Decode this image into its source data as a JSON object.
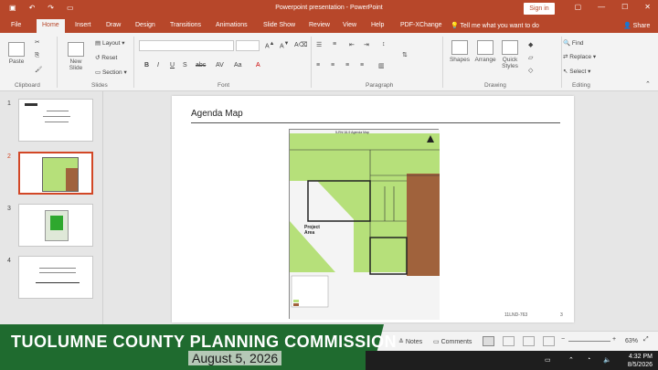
{
  "window": {
    "title": "Powerpoint presentation - PowerPoint",
    "signin": "Sign in"
  },
  "tabs": [
    "File",
    "Home",
    "Insert",
    "Draw",
    "Design",
    "Transitions",
    "Animations",
    "Slide Show",
    "Review",
    "View",
    "Help",
    "PDF-XChange"
  ],
  "active_tab": "Home",
  "tellme": "Tell me what you want to do",
  "share": "Share",
  "ribbon": {
    "clipboard": {
      "label": "Clipboard",
      "paste": "Paste"
    },
    "slides": {
      "label": "Slides",
      "new_slide": "New Slide",
      "layout": "Layout",
      "reset": "Reset",
      "section": "Section"
    },
    "font": {
      "label": "Font",
      "bold": "B",
      "italic": "I",
      "underline": "U",
      "shadow": "S",
      "strike": "abc"
    },
    "paragraph": {
      "label": "Paragraph"
    },
    "drawing": {
      "label": "Drawing",
      "shapes": "Shapes",
      "arrange": "Arrange",
      "quick_styles": "Quick Styles"
    },
    "editing": {
      "label": "Editing",
      "find": "Find",
      "replace": "Replace",
      "select": "Select"
    }
  },
  "thumbnails": [
    {
      "num": "1",
      "selected": false
    },
    {
      "num": "2",
      "selected": true
    },
    {
      "num": "3",
      "selected": false
    },
    {
      "num": "4",
      "selected": false
    }
  ],
  "slide": {
    "title": "Agenda Map",
    "map_header": "5-Rhl 16-9 Agenda Map",
    "project_label": "Project Area",
    "code": "11LND-763",
    "page": "3"
  },
  "status": {
    "notes": "Notes",
    "comments": "Comments",
    "zoom": "63%"
  },
  "banner": {
    "title": "TUOLUMNE COUNTY PLANNING COMMISSION",
    "date": "August 5, 2026"
  },
  "clock": {
    "time": "4:32 PM",
    "date": "8/5/2026"
  },
  "colors": {
    "accent": "#b7472a",
    "banner": "#1f6b2f",
    "parcel_green": "#b6e07a",
    "parcel_brown": "#a0623c"
  }
}
